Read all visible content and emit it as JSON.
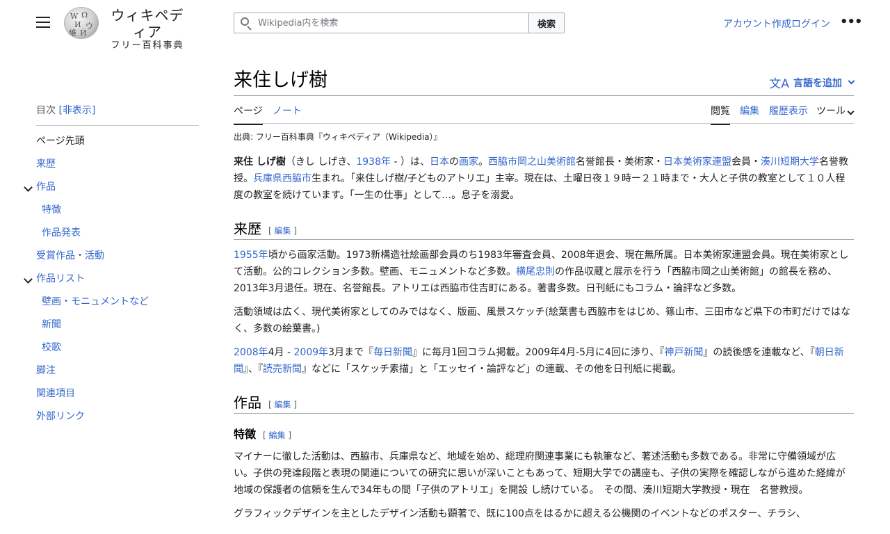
{
  "header": {
    "logo_title": "ウィキペディア",
    "logo_subtitle": "フリー百科事典",
    "search_placeholder": "Wikipedia内を検索",
    "search_button": "検索",
    "create_account": "アカウント作成",
    "login": "ログイン"
  },
  "toc": {
    "heading": "目次",
    "hide_label": "[非表示]",
    "items": [
      {
        "label": "ページ先頭"
      },
      {
        "label": "来歴"
      },
      {
        "label": "作品"
      },
      {
        "label": "特徴"
      },
      {
        "label": "作品発表"
      },
      {
        "label": "受賞作品・活動"
      },
      {
        "label": "作品リスト"
      },
      {
        "label": "壁画・モニュメントなど"
      },
      {
        "label": "新聞"
      },
      {
        "label": "校歌"
      },
      {
        "label": "脚注"
      },
      {
        "label": "関連項目"
      },
      {
        "label": "外部リンク"
      }
    ]
  },
  "article": {
    "title": "来住しげ樹",
    "lang_button": "言語を追加",
    "tabs": {
      "page": "ページ",
      "talk": "ノート",
      "read": "閲覧",
      "edit": "編集",
      "history": "履歴表示",
      "tools": "ツール"
    },
    "source_note": "出典: フリー百科事典『ウィキペディア（Wikipedia）』",
    "edit_label": "編集",
    "sections": {
      "history": "来歴",
      "works": "作品",
      "features": "特徴"
    },
    "intro": {
      "name": "来住 しげ樹",
      "reading_open": "（きし しげき、",
      "year": "1938年",
      "seg1": " - ）は、",
      "japan": "日本",
      "no": "の",
      "painter": "画家",
      "period": "。",
      "museum": "西脇市岡之山美術館",
      "seg2": "名誉館長・美術家・",
      "federation": "日本美術家連盟",
      "seg3": "会員・",
      "college": "湊川短期大学",
      "seg4": "名誉教授。",
      "pref": "兵庫県",
      "city": "西脇市",
      "seg5": "生まれ。「来住しげ樹/子どものアトリエ」主宰。現在は、土曜日夜１９時ー２１時まで・大人と子供の教室として１０人程度の教室を続けています。「一生の仕事」として…。息子を溺愛。"
    },
    "history": {
      "p1_year": "1955年",
      "p1_a": "頃から画家活動。1973新構造社絵画部会員のち1983年審査会員、2008年退会、現在無所属。日本美術家連盟会員。現在美術家として活動。公的コレクション多数。壁画、モニュメントなど多数。",
      "p1_artist": "横尾忠則",
      "p1_b": "の作品収蔵と展示を行う「西脇市岡之山美術館」の館長を務め、2013年3月退任。現在、名誉館長。アトリエは西脇市住吉町にある。著書多数。日刊紙にもコラム・論評など多数。",
      "p2": "活動領域は広く、現代美術家としてのみではなく、版画、風景スケッチ(絵葉書も西脇市をはじめ、篠山市、三田市など県下の市町だけではなく、多数の絵葉書。)",
      "p3_y1": "2008年",
      "p3_a": "4月 - ",
      "p3_y2": "2009年",
      "p3_b": "3月まで『",
      "p3_mainichi": "毎日新聞",
      "p3_c": "』に毎月1回コラム掲載。2009年4月-5月に4回に渉り、『",
      "p3_kobe": "神戸新聞",
      "p3_d": "』の読後感を連載など、『",
      "p3_asahi": "朝日新聞",
      "p3_e": "』、『",
      "p3_yomiuri": "読売新聞",
      "p3_f": "』などに「スケッチ素描」と「エッセイ・論評など」の連載、その他を日刊紙に掲載。"
    },
    "features": {
      "p1": "マイナーに徹した活動は、西脇市、兵庫県など、地域を始め、総理府関連事業にも執筆など、著述活動も多数である。非常に守備領域が広い。子供の発達段階と表現の関連についての研究に思いが深いこともあって、短期大学での講座も、子供の実際を確認しながら進めた経緯が地域の保護者の信頼を生んで34年もの間「子供のアトリエ」を開設 し続けている。　その間、湊川短期大学教授・現在　名誉教授。",
      "p2": "グラフィックデザインを主としたデザイン活動も顕著で、既に100点をはるかに超える公機関のイベントなどのポスター、チラシ、"
    }
  }
}
